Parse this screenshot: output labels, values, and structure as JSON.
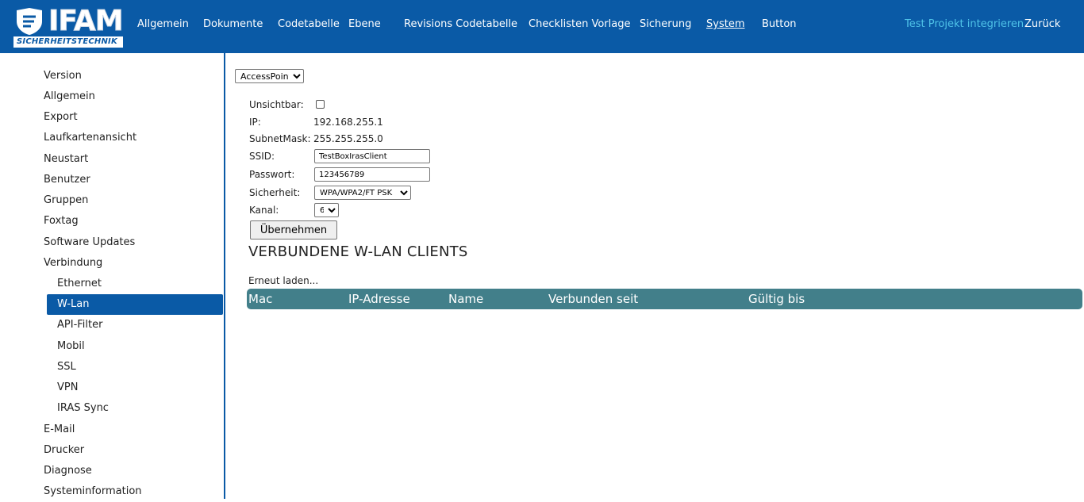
{
  "logo": {
    "word": "IFAM",
    "subtitle": "SICHERHEITSTECHNIK"
  },
  "nav": {
    "items": [
      {
        "label": "Allgemein"
      },
      {
        "label": "Dokumente"
      },
      {
        "label": "Codetabelle"
      },
      {
        "label": "Ebene"
      },
      {
        "label": "Revisions Codetabelle"
      },
      {
        "label": "Checklisten Vorlage"
      },
      {
        "label": "Sicherung"
      },
      {
        "label": "System"
      },
      {
        "label": "Button"
      }
    ],
    "active": "System",
    "integrate_label": "Test Projekt integrieren",
    "back_label": "Zurück"
  },
  "colors": {
    "topbar": "#0a5aa6",
    "integrate_link": "#4fc3e8",
    "table_header": "#427f8a"
  },
  "sidebar": {
    "items": [
      {
        "label": "Version"
      },
      {
        "label": "Allgemein"
      },
      {
        "label": "Export"
      },
      {
        "label": "Laufkartenansicht"
      },
      {
        "label": "Neustart"
      },
      {
        "label": "Benutzer"
      },
      {
        "label": "Gruppen"
      },
      {
        "label": "Foxtag"
      },
      {
        "label": "Software Updates"
      },
      {
        "label": "Verbindung"
      },
      {
        "label": "Ethernet"
      },
      {
        "label": "W-Lan"
      },
      {
        "label": "API-Filter"
      },
      {
        "label": "Mobil"
      },
      {
        "label": "SSL"
      },
      {
        "label": "VPN"
      },
      {
        "label": "IRAS Sync"
      },
      {
        "label": "E-Mail"
      },
      {
        "label": "Drucker"
      },
      {
        "label": "Diagnose"
      },
      {
        "label": "Systeminformation"
      }
    ],
    "active": "W-Lan"
  },
  "wlan": {
    "mode": "AccessPoint",
    "invisible_label": "Unsichtbar:",
    "ip_label": "IP:",
    "ip_value": "192.168.255.1",
    "subnet_label": "SubnetMask:",
    "subnet_value": "255.255.255.0",
    "ssid_label": "SSID:",
    "ssid_value": "TestBoxIrasClient",
    "password_label": "Passwort:",
    "password_value": "123456789",
    "security_label": "Sicherheit:",
    "security_value": "WPA/WPA2/FT PSK",
    "channel_label": "Kanal:",
    "channel_value": "6",
    "apply_label": "Übernehmen"
  },
  "clients": {
    "heading": "VERBUNDENE W-LAN CLIENTS",
    "reload_label": "Erneut laden...",
    "columns": [
      "Mac",
      "IP-Adresse",
      "Name",
      "Verbunden seit",
      "Gültig bis"
    ]
  }
}
